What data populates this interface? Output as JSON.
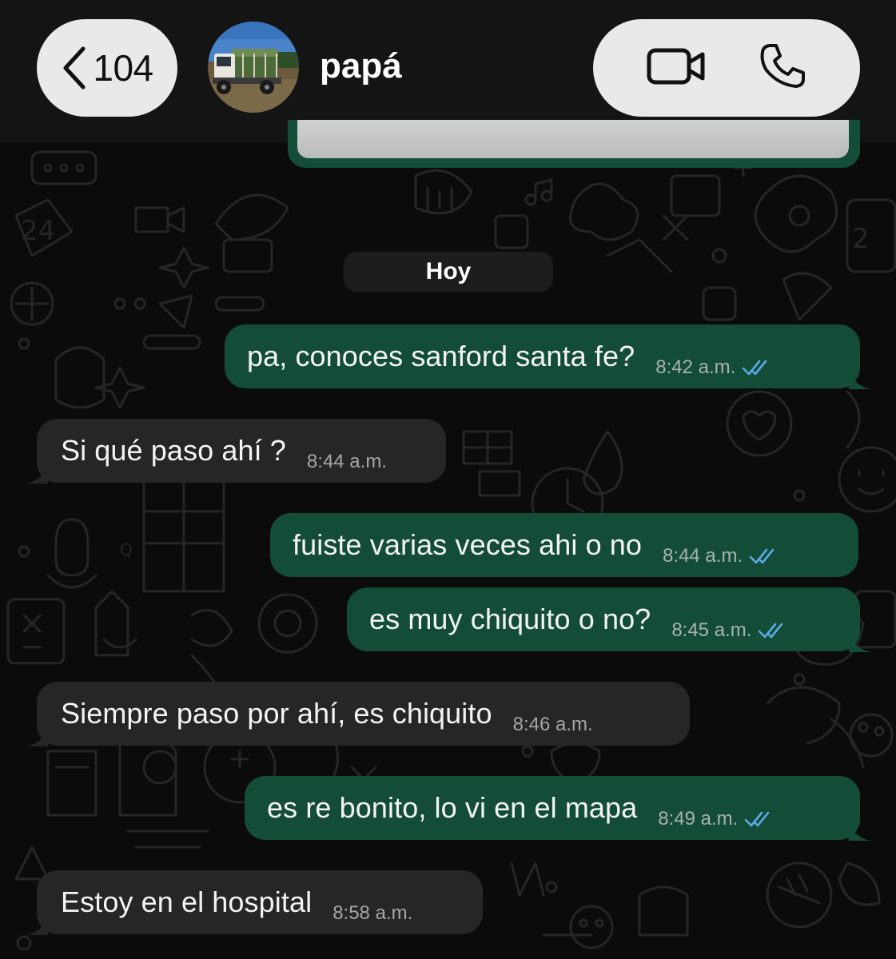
{
  "colors": {
    "header_bg": "#141414",
    "pill_bg": "#e9e9ea",
    "outgoing_bubble": "#134d37",
    "incoming_bubble": "#262626",
    "read_ticks": "#5aa9e6",
    "chat_bg": "#0b0b0b"
  },
  "header": {
    "back_count": "104",
    "back_icon": "chevron-left-icon",
    "contact_name": "papá",
    "avatar_icon": "truck-photo-avatar",
    "video_icon": "video-camera-icon",
    "call_icon": "phone-icon"
  },
  "chat": {
    "date_label": "Hoy",
    "messages": [
      {
        "direction": "out",
        "text": "pa, conoces sanford santa fe?",
        "time": "8:42 a.m.",
        "status": "read"
      },
      {
        "direction": "in",
        "text": "Si qué paso ahí ?",
        "time": "8:44 a.m."
      },
      {
        "direction": "out",
        "text": "fuiste varias veces ahi o no",
        "time": "8:44 a.m.",
        "status": "read"
      },
      {
        "direction": "out",
        "text": "es muy chiquito o no?",
        "time": "8:45 a.m.",
        "status": "read"
      },
      {
        "direction": "in",
        "text": "Siempre paso por ahí, es chiquito",
        "time": "8:46 a.m."
      },
      {
        "direction": "out",
        "text": "es re bonito, lo vi en el mapa",
        "time": "8:49 a.m.",
        "status": "read"
      },
      {
        "direction": "in",
        "text": "Estoy en el hospital",
        "time": "8:58 a.m."
      }
    ]
  }
}
